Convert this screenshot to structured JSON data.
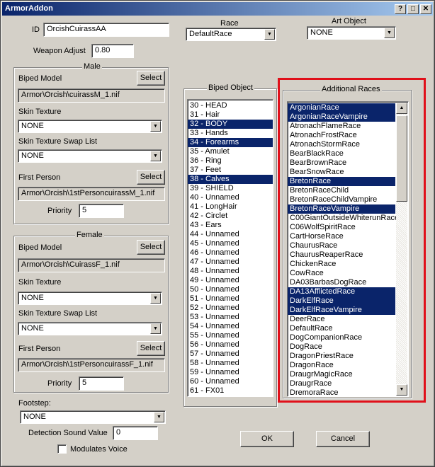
{
  "window": {
    "title": "ArmorAddon"
  },
  "titlebar_buttons": {
    "help": "?",
    "minimize": "_",
    "maximize": "□",
    "close": "✕"
  },
  "form": {
    "id_label": "ID",
    "id_value": "OrcishCuirassAA",
    "weapon_adjust_label": "Weapon Adjust",
    "weapon_adjust_value": "0.80",
    "race_label": "Race",
    "race_value": "DefaultRace",
    "art_object_label": "Art Object",
    "art_object_value": "NONE"
  },
  "male": {
    "title": "Male",
    "biped_model_label": "Biped Model",
    "biped_model_select": "Select",
    "biped_model_path": "Armor\\Orcish\\cuirassM_1.nif",
    "skin_texture_label": "Skin Texture",
    "skin_texture_value": "NONE",
    "swap_list_label": "Skin Texture Swap List",
    "swap_list_value": "NONE",
    "first_person_label": "First Person",
    "first_person_select": "Select",
    "first_person_path": "Armor\\Orcish\\1stPersoncuirassM_1.nif",
    "priority_label": "Priority",
    "priority_value": "5"
  },
  "female": {
    "title": "Female",
    "biped_model_label": "Biped Model",
    "biped_model_select": "Select",
    "biped_model_path": "Armor\\Orcish\\CuirassF_1.nif",
    "skin_texture_label": "Skin Texture",
    "skin_texture_value": "NONE",
    "swap_list_label": "Skin Texture Swap List",
    "swap_list_value": "NONE",
    "first_person_label": "First Person",
    "first_person_select": "Select",
    "first_person_path": "Armor\\Orcish\\1stPersoncuirassF_1.nif",
    "priority_label": "Priority",
    "priority_value": "5"
  },
  "footstep": {
    "label": "Footstep:",
    "value": "NONE"
  },
  "detection": {
    "label": "Detection Sound Value",
    "value": "0"
  },
  "modulates_voice": {
    "label": "Modulates Voice",
    "checked": false
  },
  "biped_object": {
    "title": "Biped Object",
    "items": [
      {
        "label": "30 - HEAD",
        "selected": false
      },
      {
        "label": "31 - Hair",
        "selected": false
      },
      {
        "label": "32 - BODY",
        "selected": true
      },
      {
        "label": "33 - Hands",
        "selected": false
      },
      {
        "label": "34 - Forearms",
        "selected": true
      },
      {
        "label": "35 - Amulet",
        "selected": false
      },
      {
        "label": "36 - Ring",
        "selected": false
      },
      {
        "label": "37 - Feet",
        "selected": false
      },
      {
        "label": "38 - Calves",
        "selected": true
      },
      {
        "label": "39 - SHIELD",
        "selected": false
      },
      {
        "label": "40 - Unnamed",
        "selected": false
      },
      {
        "label": "41 - LongHair",
        "selected": false
      },
      {
        "label": "42 - Circlet",
        "selected": false
      },
      {
        "label": "43 - Ears",
        "selected": false
      },
      {
        "label": "44 - Unnamed",
        "selected": false
      },
      {
        "label": "45 - Unnamed",
        "selected": false
      },
      {
        "label": "46 - Unnamed",
        "selected": false
      },
      {
        "label": "47 - Unnamed",
        "selected": false
      },
      {
        "label": "48 - Unnamed",
        "selected": false
      },
      {
        "label": "49 - Unnamed",
        "selected": false
      },
      {
        "label": "50 - Unnamed",
        "selected": false
      },
      {
        "label": "51 - Unnamed",
        "selected": false
      },
      {
        "label": "52 - Unnamed",
        "selected": false
      },
      {
        "label": "53 - Unnamed",
        "selected": false
      },
      {
        "label": "54 - Unnamed",
        "selected": false
      },
      {
        "label": "55 - Unnamed",
        "selected": false
      },
      {
        "label": "56 - Unnamed",
        "selected": false
      },
      {
        "label": "57 - Unnamed",
        "selected": false
      },
      {
        "label": "58 - Unnamed",
        "selected": false
      },
      {
        "label": "59 - Unnamed",
        "selected": false
      },
      {
        "label": "60 - Unnamed",
        "selected": false
      },
      {
        "label": "61 - FX01",
        "selected": false
      }
    ]
  },
  "additional_races": {
    "title": "Additional Races",
    "items": [
      {
        "label": "ArgonianRace",
        "selected": true
      },
      {
        "label": "ArgonianRaceVampire",
        "selected": true
      },
      {
        "label": "AtronachFlameRace",
        "selected": false
      },
      {
        "label": "AtronachFrostRace",
        "selected": false
      },
      {
        "label": "AtronachStormRace",
        "selected": false
      },
      {
        "label": "BearBlackRace",
        "selected": false
      },
      {
        "label": "BearBrownRace",
        "selected": false
      },
      {
        "label": "BearSnowRace",
        "selected": false
      },
      {
        "label": "BretonRace",
        "selected": true
      },
      {
        "label": "BretonRaceChild",
        "selected": false
      },
      {
        "label": "BretonRaceChildVampire",
        "selected": false
      },
      {
        "label": "BretonRaceVampire",
        "selected": true
      },
      {
        "label": "C00GiantOutsideWhiterunRace",
        "selected": false
      },
      {
        "label": "C06WolfSpiritRace",
        "selected": false
      },
      {
        "label": "CartHorseRace",
        "selected": false
      },
      {
        "label": "ChaurusRace",
        "selected": false
      },
      {
        "label": "ChaurusReaperRace",
        "selected": false
      },
      {
        "label": "ChickenRace",
        "selected": false
      },
      {
        "label": "CowRace",
        "selected": false
      },
      {
        "label": "DA03BarbasDogRace",
        "selected": false
      },
      {
        "label": "DA13AfflictedRace",
        "selected": true
      },
      {
        "label": "DarkElfRace",
        "selected": true
      },
      {
        "label": "DarkElfRaceVampire",
        "selected": true
      },
      {
        "label": "DeerRace",
        "selected": false
      },
      {
        "label": "DefaultRace",
        "selected": false
      },
      {
        "label": "DogCompanionRace",
        "selected": false
      },
      {
        "label": "DogRace",
        "selected": false
      },
      {
        "label": "DragonPriestRace",
        "selected": false
      },
      {
        "label": "DragonRace",
        "selected": false
      },
      {
        "label": "DraugrMagicRace",
        "selected": false
      },
      {
        "label": "DraugrRace",
        "selected": false
      },
      {
        "label": "DremoraRace",
        "selected": false
      }
    ]
  },
  "buttons": {
    "ok": "OK",
    "cancel": "Cancel"
  },
  "icons": {
    "dropdown": "▼",
    "scroll_up": "▲",
    "scroll_down": "▼"
  },
  "colors": {
    "selection": "#0a246a",
    "highlight_box": "#e0101a",
    "window_bg": "#d4d0c8"
  }
}
